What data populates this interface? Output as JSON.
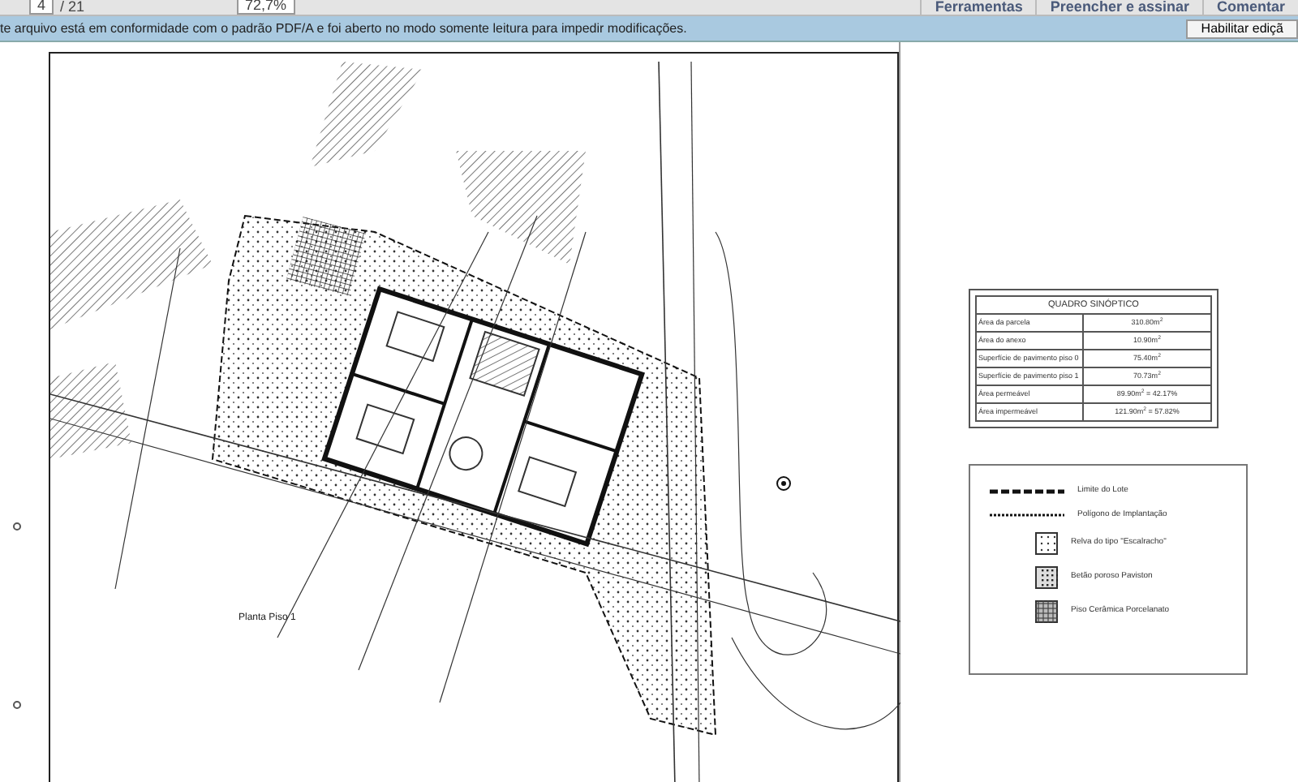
{
  "toolbar": {
    "page": "4",
    "page_count": "/ 21",
    "zoom": "72,7%",
    "tabs": [
      {
        "label": "Ferramentas",
        "selected": false
      },
      {
        "label": "Preencher e assinar",
        "selected": false
      },
      {
        "label": "Comentar",
        "selected": false
      }
    ]
  },
  "notice": {
    "text": "te arquivo está em conformidade com o padrão PDF/A e foi aberto no modo somente leitura para impedir modificações.",
    "button": "Habilitar ediçã"
  },
  "drawing": {
    "caption": "Planta Piso 1"
  },
  "summary_table": {
    "title": "QUADRO SINÓPTICO",
    "rows": [
      {
        "label": "Área da parcela",
        "value": "310.80m$^{2}$"
      },
      {
        "label": "Área do anexo",
        "value": "10.90m$^{2}$"
      },
      {
        "label": "Superfície de pavimento piso 0",
        "value": "75.40m$^{2}$"
      },
      {
        "label": "Superfície de pavimento piso 1",
        "value": "70.73m$^{2}$"
      },
      {
        "label": "Área permeável",
        "value": "89.90m$^{2}$ = 42.17%"
      },
      {
        "label": "Área impermeável",
        "value": "121.90m$^{2}$ = 57.82%"
      }
    ]
  },
  "legend": [
    {
      "kind": "dash",
      "label": "Limite do Lote"
    },
    {
      "kind": "dots",
      "label": "Polígono de Implantação"
    },
    {
      "kind": "grass",
      "label": "Relva do tipo \"Escalracho\""
    },
    {
      "kind": "porous",
      "label": "Betão poroso Paviston"
    },
    {
      "kind": "tile",
      "label": "Piso Cerâmica Porcelanato"
    }
  ]
}
